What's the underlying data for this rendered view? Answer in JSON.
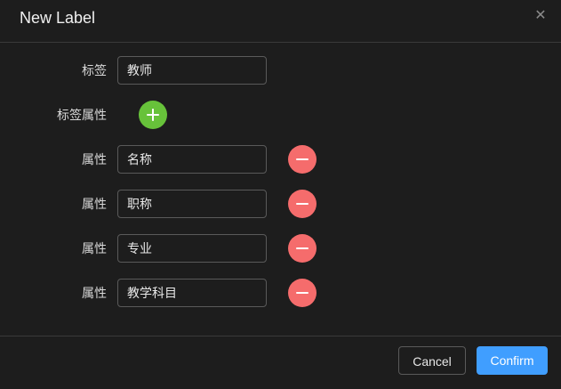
{
  "dialog": {
    "title": "New Label",
    "close_icon": "close-icon"
  },
  "form": {
    "label": {
      "label": "标签",
      "value": "教师"
    },
    "label_attributes": {
      "label": "标签属性",
      "add_icon": "plus-icon"
    },
    "attributes": [
      {
        "label": "属性",
        "value": "名称"
      },
      {
        "label": "属性",
        "value": "职称"
      },
      {
        "label": "属性",
        "value": "专业"
      },
      {
        "label": "属性",
        "value": "教学科目"
      }
    ]
  },
  "footer": {
    "cancel_label": "Cancel",
    "confirm_label": "Confirm"
  },
  "colors": {
    "add": "#67c23a",
    "remove": "#f56c6c",
    "primary": "#409eff"
  }
}
